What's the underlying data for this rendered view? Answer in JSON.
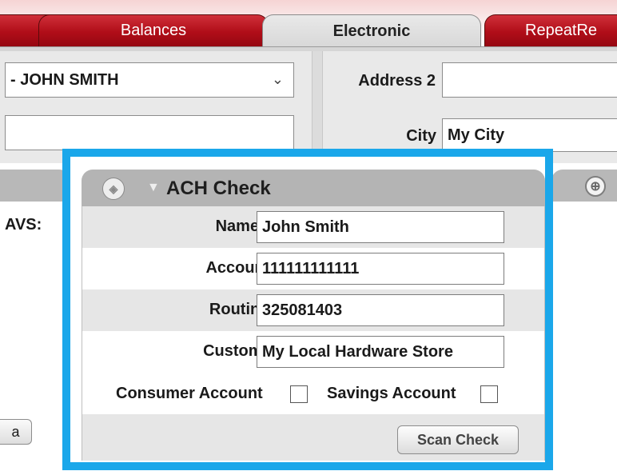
{
  "tabs": [
    {
      "label": ""
    },
    {
      "label": "Balances"
    },
    {
      "label": "Electronic"
    },
    {
      "label": "RepeatRe"
    }
  ],
  "form": {
    "customer_select_value": "- JOHN SMITH",
    "address2_label": "Address 2",
    "address2_value": "",
    "city_label": "City",
    "city_value": "My City"
  },
  "left_panel": {
    "avs_label": "AVS:",
    "button_label": "a"
  },
  "ach": {
    "title": "ACH Check",
    "name_label": "Name on check:",
    "name_value": "John  Smith",
    "account_label": "Account number:",
    "account_value": "111111111111",
    "routing_label": "Routing number:",
    "routing_value": "325081403",
    "addenda_label": "Custom addenda:",
    "addenda_value": "My Local Hardware Store",
    "consumer_label": "Consumer Account",
    "savings_label": "Savings Account",
    "scan_button": "Scan Check"
  },
  "colors": {
    "tab_red": "#b00d18",
    "highlight_blue": "#1aa7ea",
    "panel_header_gray": "#b4b4b4"
  }
}
